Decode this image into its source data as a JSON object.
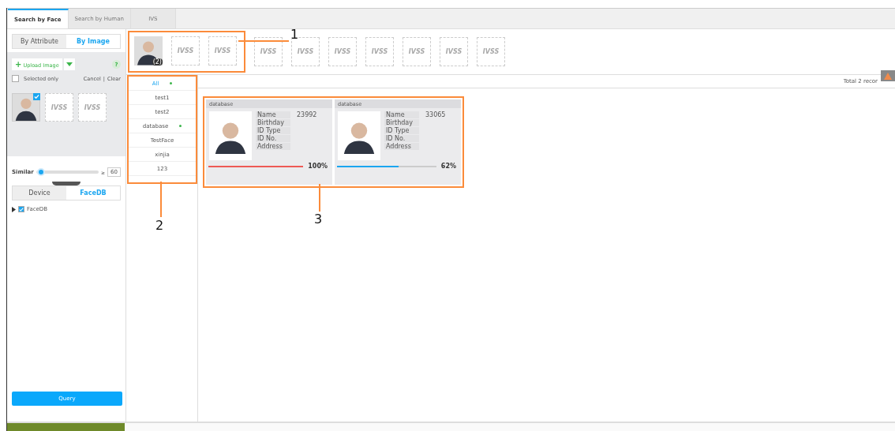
{
  "tabs": [
    {
      "label": "Search by Face",
      "selected": true
    },
    {
      "label": "Search by Human",
      "selected": false
    },
    {
      "label": "IVS",
      "selected": false
    }
  ],
  "mode_toggle": [
    {
      "label": "By Attribute",
      "selected": false
    },
    {
      "label": "By Image",
      "selected": true
    }
  ],
  "upload": {
    "icon": "+",
    "button": "Upload Image",
    "help": "?"
  },
  "selected_only": {
    "label": "Selected only",
    "checked": false
  },
  "actions": {
    "cancel": "Cancel",
    "separator": "|",
    "clear": "Clear"
  },
  "upload_slots": [
    {
      "kind": "photo",
      "checked": true
    },
    {
      "kind": "empty",
      "label": "IVSS"
    },
    {
      "kind": "empty",
      "label": "IVSS"
    }
  ],
  "similar": {
    "label": "Similar",
    "level": 0.02,
    "prefix": "≥",
    "value": "60"
  },
  "source_toggle": [
    {
      "label": "Device",
      "selected": false
    },
    {
      "label": "FaceDB",
      "selected": true
    }
  ],
  "tree": [
    {
      "label": "FaceDB",
      "checked": true,
      "expanded": false
    }
  ],
  "query_button": "Query",
  "strip": [
    {
      "kind": "photo",
      "badge": "(2)"
    },
    {
      "kind": "empty",
      "label": "IVSS"
    },
    {
      "kind": "empty",
      "label": "IVSS"
    },
    {
      "kind": "empty",
      "label": "IVSS"
    },
    {
      "kind": "empty",
      "label": "IVSS"
    },
    {
      "kind": "empty",
      "label": "IVSS"
    },
    {
      "kind": "empty",
      "label": "IVSS"
    },
    {
      "kind": "empty",
      "label": "IVSS"
    },
    {
      "kind": "empty",
      "label": "IVSS"
    },
    {
      "kind": "empty",
      "label": "IVSS"
    }
  ],
  "databases": [
    {
      "label": "All",
      "selected": true,
      "marked": true
    },
    {
      "label": "test1",
      "selected": false,
      "marked": false
    },
    {
      "label": "test2",
      "selected": false,
      "marked": false
    },
    {
      "label": "database",
      "selected": false,
      "marked": true
    },
    {
      "label": "TestFace",
      "selected": false,
      "marked": false
    },
    {
      "label": "xinjia",
      "selected": false,
      "marked": false
    },
    {
      "label": "123",
      "selected": false,
      "marked": false
    }
  ],
  "total": "Total 2 recor",
  "results": [
    {
      "group": "database",
      "fields": [
        {
          "label": "Name",
          "value": "23992"
        },
        {
          "label": "Birthday"
        },
        {
          "label": "ID Type"
        },
        {
          "label": "ID No."
        },
        {
          "label": "Address"
        }
      ],
      "level": 1.0,
      "score": "100%",
      "color": "#ee5a55"
    },
    {
      "group": "database",
      "fields": [
        {
          "label": "Name",
          "value": "33065"
        },
        {
          "label": "Birthday"
        },
        {
          "label": "ID Type"
        },
        {
          "label": "ID No."
        },
        {
          "label": "Address"
        }
      ],
      "level": 0.62,
      "score": "62%",
      "color": "#1ba6f0"
    }
  ],
  "callouts": [
    "1",
    "2",
    "3"
  ]
}
